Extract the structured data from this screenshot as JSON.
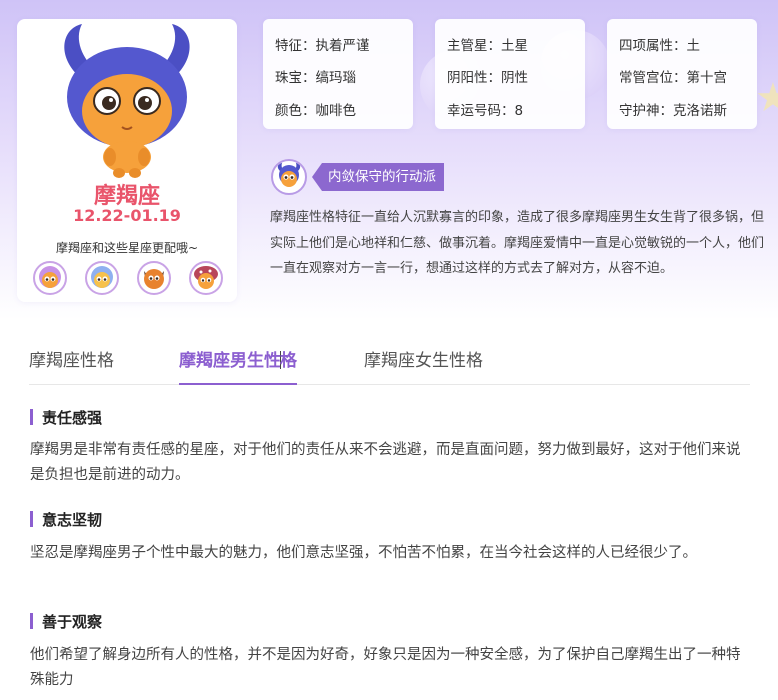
{
  "profile": {
    "name": "摩羯座",
    "dates": "12.22-01.19",
    "match_text": "摩羯座和这些星座更配哦~",
    "match_icons": [
      "libra-mascot-icon",
      "aquarius-mascot-icon",
      "taurus-mascot-icon",
      "virgo-mascot-icon"
    ]
  },
  "attributes": [
    [
      {
        "label": "特征：",
        "value": "执着严谨"
      },
      {
        "label": "珠宝：",
        "value": "缟玛瑙"
      },
      {
        "label": "颜色：",
        "value": "咖啡色"
      }
    ],
    [
      {
        "label": "主管星：",
        "value": "土星"
      },
      {
        "label": "阴阳性：",
        "value": "阴性"
      },
      {
        "label": "幸运号码：",
        "value": "8"
      }
    ],
    [
      {
        "label": "四项属性：",
        "value": "土"
      },
      {
        "label": "常管宫位：",
        "value": "第十宫"
      },
      {
        "label": "守护神：",
        "value": "克洛诺斯"
      }
    ]
  ],
  "badge": "内敛保守的行动派",
  "intro": "摩羯座性格特征一直给人沉默寡言的印象，造成了很多摩羯座男生女生背了很多锅，但实际上他们是心地祥和仁慈、做事沉着。摩羯座爱情中一直是心觉敏锐的一个人，他们一直在观察对方一言一行，想通过这样的方式去了解对方，从容不迫。",
  "tabs": [
    {
      "label": "摩羯座性格",
      "active": false
    },
    {
      "label_before": "摩羯座男生性",
      "label_after": "格",
      "active": true
    },
    {
      "label": "摩羯座女生性格",
      "active": false
    }
  ],
  "sections": [
    {
      "title": "责任感强",
      "body": "摩羯男是非常有责任感的星座，对于他们的责任从来不会逃避，而是直面问题，努力做到最好，这对于他们来说是负担也是前进的动力。"
    },
    {
      "title": "意志坚韧",
      "body": "坚忍是摩羯座男子个性中最大的魅力，他们意志坚强，不怕苦不怕累，在当今社会这样的人已经很少了。"
    },
    {
      "title": "善于观察",
      "body": "他们希望了解身边所有人的性格，并不是因为好奇，好象只是因为一种安全感，为了保护自己摩羯生出了一种特殊能力"
    }
  ],
  "colors": {
    "accent": "#8c5fd0",
    "sign_red": "#e9546b",
    "mascot_body": "#f6a13b",
    "mascot_hat": "#4b4fc4"
  }
}
